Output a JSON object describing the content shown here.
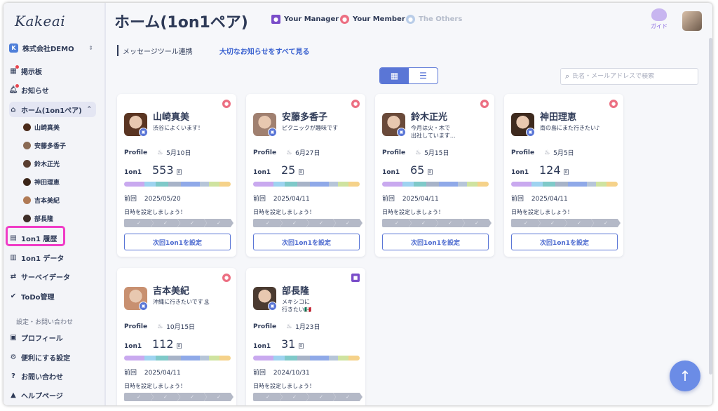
{
  "app": {
    "logo": "Kakeai",
    "company": "株式会社DEMO",
    "company_icon": "K"
  },
  "sidebar": {
    "items": [
      {
        "label": "掲示板",
        "icon": "board-icon",
        "dot": true
      },
      {
        "label": "お知らせ",
        "icon": "bell-icon",
        "dot": true
      },
      {
        "label": "ホーム(1on1ペア)",
        "icon": "home-icon",
        "active": true
      },
      {
        "label": "1on1 履歴",
        "icon": "history-icon",
        "highlighted": true
      },
      {
        "label": "1on1 データ",
        "icon": "chart-icon"
      },
      {
        "label": "サーベイデータ",
        "icon": "survey-icon"
      },
      {
        "label": "ToDo管理",
        "icon": "check-icon"
      }
    ],
    "sub_items": [
      {
        "label": "山崎真美",
        "color": "#4a2a1a"
      },
      {
        "label": "安藤多香子",
        "color": "#8a6a55"
      },
      {
        "label": "鈴木正光",
        "color": "#5a3e30"
      },
      {
        "label": "神田理恵",
        "color": "#3a2418"
      },
      {
        "label": "吉本美紀",
        "color": "#b07a55"
      },
      {
        "label": "部長隆",
        "color": "#3e2e28"
      }
    ],
    "section_label": "設定・お問い合わせ",
    "settings_items": [
      {
        "label": "プロフィール",
        "icon": "profile-icon"
      },
      {
        "label": "便利にする設定",
        "icon": "gear-icon"
      },
      {
        "label": "お問い合わせ",
        "icon": "question-icon"
      },
      {
        "label": "ヘルプページ",
        "icon": "graduation-icon"
      }
    ]
  },
  "header": {
    "title": "ホーム(1on1ペア)",
    "legend": [
      {
        "label": "Your Manager",
        "color": "#7a4dc9"
      },
      {
        "label": "Your Member",
        "color": "#ec6f82"
      },
      {
        "label": "The Others",
        "color": "#b9cde8"
      }
    ],
    "guide_label": "ガイド"
  },
  "toolbar": {
    "integration": "メッセージツール連携",
    "notices_link": "大切なお知らせをすべて見る",
    "search_placeholder": "氏名・メールアドレスで検索"
  },
  "card_labels": {
    "profile": "Profile",
    "oneone": "1on1",
    "unit": "回",
    "last": "前回",
    "hint": "日時を設定しましょう！",
    "next_button": "次回1on1を設定"
  },
  "cards": [
    {
      "name": "山崎真美",
      "status": "渋谷によくいます！",
      "birthday": "5月10日",
      "count": "553",
      "last_date": "2025/05/20",
      "role": "member",
      "photo": "#5a3522"
    },
    {
      "name": "安藤多香子",
      "status": "ピクニックが趣味です",
      "birthday": "6月27日",
      "count": "25",
      "last_date": "2025/04/11",
      "role": "member",
      "photo": "#a08070"
    },
    {
      "name": "鈴木正光",
      "status": "今月は火・木で\n出社しています…",
      "birthday": "5月15日",
      "count": "65",
      "last_date": "2025/04/11",
      "role": "member",
      "photo": "#6a4a3a"
    },
    {
      "name": "神田理恵",
      "status": "南の島にまた行きたい♪",
      "birthday": "5月5日",
      "count": "124",
      "last_date": "2025/04/11",
      "role": "member",
      "photo": "#3e2a1e"
    },
    {
      "name": "吉本美紀",
      "status": "沖縄に行きたいです🏝",
      "birthday": "10月15日",
      "count": "112",
      "last_date": "2025/04/11",
      "role": "member",
      "photo": "#c89070"
    },
    {
      "name": "部長隆",
      "status": "メキシコに\n行きたい🇲🇽",
      "birthday": "1月23日",
      "count": "31",
      "last_date": "2024/10/31",
      "role": "manager",
      "photo": "#4a3a30"
    }
  ],
  "bar_colors": [
    "#c9a9ef",
    "#9ed3f0",
    "#7fc9c9",
    "#a7b3c8",
    "#8fa9e8",
    "#b6c5d8",
    "#cfe3a0",
    "#f5d28a"
  ]
}
